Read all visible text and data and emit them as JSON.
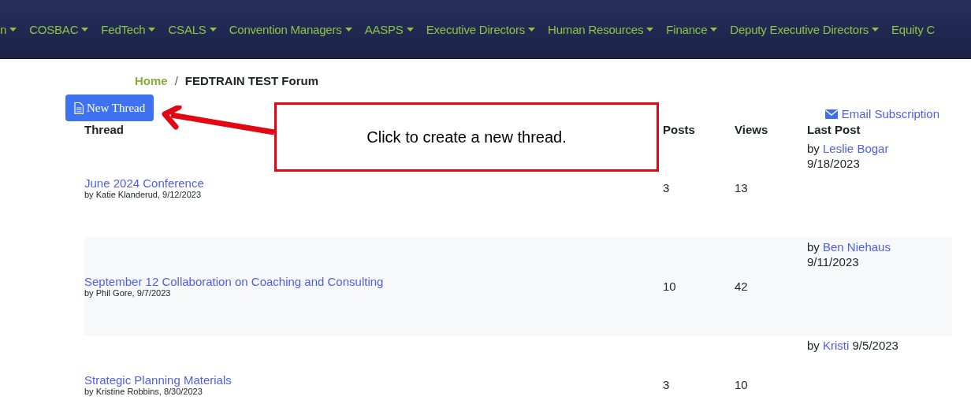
{
  "nav": {
    "items": [
      {
        "label": "n",
        "caret": true
      },
      {
        "label": "COSBAC",
        "caret": true
      },
      {
        "label": "FedTech",
        "caret": true
      },
      {
        "label": "CSALS",
        "caret": true
      },
      {
        "label": "Convention Managers",
        "caret": true
      },
      {
        "label": "AASPS",
        "caret": true
      },
      {
        "label": "Executive Directors",
        "caret": true
      },
      {
        "label": "Human Resources",
        "caret": true
      },
      {
        "label": "Finance",
        "caret": true
      },
      {
        "label": "Deputy Executive Directors",
        "caret": true
      },
      {
        "label": "Equity C",
        "caret": false
      }
    ]
  },
  "breadcrumb": {
    "separator": "/",
    "items": [
      {
        "label": "Home",
        "kind": "link"
      },
      {
        "label": "FEDTRAIN TEST Forum",
        "kind": "current"
      }
    ]
  },
  "new_thread_button": "New Thread",
  "email_subscription": "Email Subscription",
  "callout": "Click to create a new thread.",
  "table": {
    "columns": [
      "Thread",
      "Posts",
      "Views",
      "Last Post"
    ],
    "rows": [
      {
        "title": "June 2024 Conference",
        "byline": "by Katie Klanderud, 9/12/2023",
        "posts": "3",
        "views": "13",
        "last_post": {
          "prefix": "by",
          "author": "Leslie Bogar",
          "date": "9/18/2023"
        }
      },
      {
        "title": "September 12 Collaboration on Coaching and Consulting",
        "byline": "by Phil Gore, 9/7/2023",
        "posts": "10",
        "views": "42",
        "last_post": {
          "prefix": "by",
          "author": "Ben Niehaus",
          "date": "9/11/2023"
        }
      },
      {
        "title": "Strategic Planning Materials",
        "byline": "by Kristine Robbins, 8/30/2023",
        "posts": "3",
        "views": "10",
        "last_post": {
          "prefix": "by",
          "author": "Kristi",
          "date": "9/5/2023"
        }
      }
    ]
  }
}
